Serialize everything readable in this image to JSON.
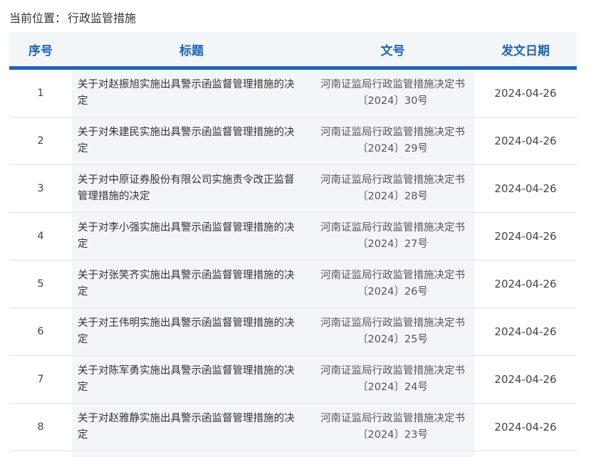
{
  "breadcrumb": {
    "label": "当前位置：",
    "current": "行政监管措施"
  },
  "table": {
    "headers": {
      "index": "序号",
      "title": "标题",
      "doc_number": "文号",
      "date": "发文日期"
    },
    "rows": [
      {
        "index": "1",
        "title": "关于对赵振旭实施出具警示函监督管理措施的决定",
        "doc_number": "河南证监局行政监管措施决定书〔2024〕30号",
        "date": "2024-04-26"
      },
      {
        "index": "2",
        "title": "关于对朱建民实施出具警示函监督管理措施的决定",
        "doc_number": "河南证监局行政监管措施决定书〔2024〕29号",
        "date": "2024-04-26"
      },
      {
        "index": "3",
        "title": "关于对中原证券股份有限公司实施责令改正监督管理措施的决定",
        "doc_number": "河南证监局行政监管措施决定书〔2024〕28号",
        "date": "2024-04-26"
      },
      {
        "index": "4",
        "title": "关于对李小强实施出具警示函监督管理措施的决定",
        "doc_number": "河南证监局行政监管措施决定书〔2024〕27号",
        "date": "2024-04-26"
      },
      {
        "index": "5",
        "title": "关于对张笑齐实施出具警示函监督管理措施的决定",
        "doc_number": "河南证监局行政监管措施决定书〔2024〕26号",
        "date": "2024-04-26"
      },
      {
        "index": "6",
        "title": "关于对王伟明实施出具警示函监督管理措施的决定",
        "doc_number": "河南证监局行政监管措施决定书〔2024〕25号",
        "date": "2024-04-26"
      },
      {
        "index": "7",
        "title": "关于对陈军勇实施出具警示函监督管理措施的决定",
        "doc_number": "河南证监局行政监管措施决定书〔2024〕24号",
        "date": "2024-04-26"
      },
      {
        "index": "8",
        "title": "关于对赵雅静实施出具警示函监督管理措施的决定",
        "doc_number": "河南证监局行政监管措施决定书〔2024〕23号",
        "date": "2024-04-26"
      }
    ]
  },
  "colors": {
    "accent": "#1e64b4",
    "header_bg": "#f3f6f9",
    "cell_shade": "#f3f6f9",
    "row_border": "#e2e2e2"
  }
}
